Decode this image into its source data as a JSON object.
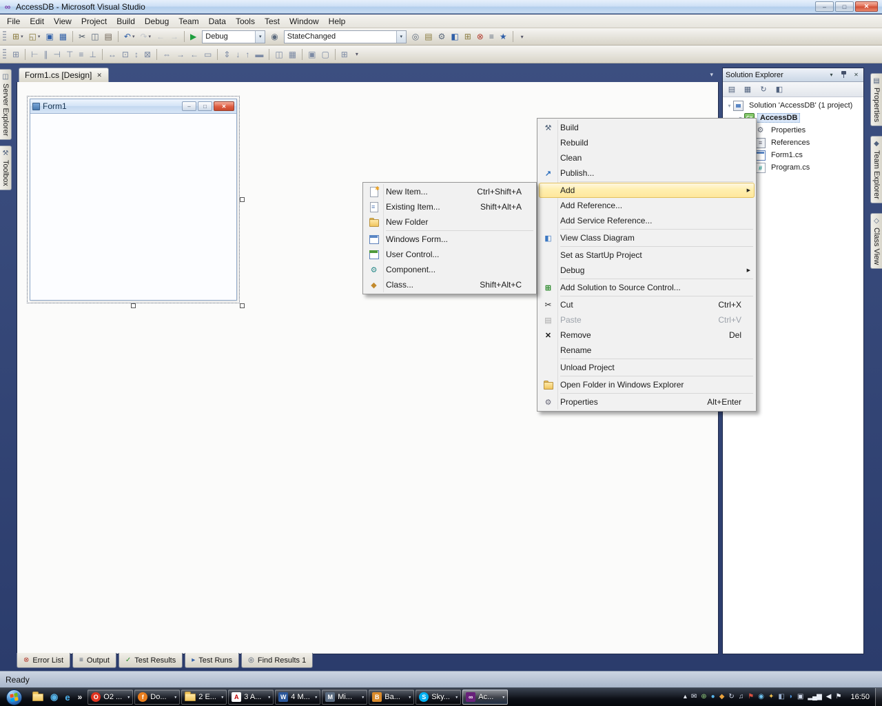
{
  "window": {
    "title": "AccessDB - Microsoft Visual Studio"
  },
  "icons": {
    "vs_logo": "∞",
    "minimize": "–",
    "maximize": "□",
    "close": "✕",
    "tab_close": "✕",
    "caret": "▾"
  },
  "menu_bar": [
    "File",
    "Edit",
    "View",
    "Project",
    "Build",
    "Debug",
    "Team",
    "Data",
    "Tools",
    "Test",
    "Window",
    "Help"
  ],
  "standard_toolbar": [
    {
      "type": "grip"
    },
    {
      "type": "button",
      "name": "add-new-item-button",
      "glyph": "⊞",
      "color": "#8a7b3f",
      "dropdown": true
    },
    {
      "type": "button",
      "name": "open-file-button",
      "glyph": "◱",
      "color": "#8a7b3f",
      "dropdown": true
    },
    {
      "type": "button",
      "name": "save-button",
      "glyph": "▣",
      "color": "#2f5fa8"
    },
    {
      "type": "button",
      "name": "save-all-button",
      "glyph": "▦",
      "color": "#2f5fa8"
    },
    {
      "type": "sep"
    },
    {
      "type": "button",
      "name": "cut-button",
      "glyph": "✂",
      "color": "#44505f"
    },
    {
      "type": "button",
      "name": "copy-button",
      "glyph": "◫",
      "color": "#5c6a7d"
    },
    {
      "type": "button",
      "name": "paste-button",
      "glyph": "▤",
      "color": "#6f6456"
    },
    {
      "type": "sep"
    },
    {
      "type": "button",
      "name": "undo-button",
      "glyph": "↶",
      "color": "#2f5fa8",
      "dropdown": true
    },
    {
      "type": "button",
      "name": "redo-button",
      "glyph": "↷",
      "color": "#9aa4b5",
      "dropdown": true,
      "disabled": true
    },
    {
      "type": "button",
      "name": "navigate-backward-button",
      "glyph": "←",
      "color": "#9aa4b5",
      "disabled": true
    },
    {
      "type": "button",
      "name": "navigate-forward-button",
      "glyph": "→",
      "color": "#9aa4b5",
      "disabled": true
    },
    {
      "type": "sep"
    },
    {
      "type": "button",
      "name": "start-debugging-button",
      "glyph": "▶",
      "color": "#1e9e3e"
    },
    {
      "type": "combo",
      "name": "solution-configurations-combo",
      "value": "Debug",
      "width": 92
    },
    {
      "type": "button",
      "name": "find-symbol-button",
      "glyph": "◉",
      "color": "#5c6a7d"
    },
    {
      "type": "combo",
      "name": "find-combo",
      "value": "StateChanged",
      "width": 178
    },
    {
      "type": "button",
      "name": "find-in-files-button",
      "glyph": "◎",
      "color": "#5c6a7d"
    },
    {
      "type": "button",
      "name": "solution-explorer-button",
      "glyph": "▤",
      "color": "#8a7b3f"
    },
    {
      "type": "button",
      "name": "properties-window-button",
      "glyph": "⚙",
      "color": "#5c6a7d"
    },
    {
      "type": "button",
      "name": "object-browser-button",
      "glyph": "◧",
      "color": "#2f5fa8"
    },
    {
      "type": "button",
      "name": "toolbox-button",
      "glyph": "⊞",
      "color": "#8a7b3f"
    },
    {
      "type": "button",
      "name": "error-list-button",
      "glyph": "⊗",
      "color": "#b23b2e"
    },
    {
      "type": "button",
      "name": "immediate-window-button",
      "glyph": "≡",
      "color": "#5c6a7d"
    },
    {
      "type": "button",
      "name": "start-page-button",
      "glyph": "★",
      "color": "#2f5fa8"
    },
    {
      "type": "sep"
    },
    {
      "type": "overflow",
      "name": "standard-toolbar-options"
    }
  ],
  "layout_toolbar": [
    {
      "type": "grip"
    },
    {
      "type": "button",
      "name": "snap-to-grid-button",
      "glyph": "⊞",
      "color": "#7c8aa4"
    },
    {
      "type": "sep"
    },
    {
      "type": "button",
      "name": "align-lefts-button",
      "glyph": "⊢",
      "color": "#7c8aa4"
    },
    {
      "type": "button",
      "name": "align-centers-button",
      "glyph": "∥",
      "color": "#7c8aa4"
    },
    {
      "type": "button",
      "name": "align-rights-button",
      "glyph": "⊣",
      "color": "#7c8aa4"
    },
    {
      "type": "button",
      "name": "align-tops-button",
      "glyph": "⊤",
      "color": "#7c8aa4"
    },
    {
      "type": "button",
      "name": "align-middles-button",
      "glyph": "≡",
      "color": "#7c8aa4"
    },
    {
      "type": "button",
      "name": "align-bottoms-button",
      "glyph": "⊥",
      "color": "#7c8aa4"
    },
    {
      "type": "sep"
    },
    {
      "type": "button",
      "name": "make-same-width-button",
      "glyph": "↔",
      "color": "#7c8aa4"
    },
    {
      "type": "button",
      "name": "size-to-grid-button",
      "glyph": "⊡",
      "color": "#7c8aa4"
    },
    {
      "type": "button",
      "name": "make-same-height-button",
      "glyph": "↕",
      "color": "#7c8aa4"
    },
    {
      "type": "button",
      "name": "make-same-size-button",
      "glyph": "⊠",
      "color": "#7c8aa4"
    },
    {
      "type": "sep"
    },
    {
      "type": "button",
      "name": "make-horizontal-spacing-equal-button",
      "glyph": "⇔",
      "color": "#7c8aa4"
    },
    {
      "type": "button",
      "name": "increase-horizontal-spacing-button",
      "glyph": "→",
      "color": "#7c8aa4"
    },
    {
      "type": "button",
      "name": "decrease-horizontal-spacing-button",
      "glyph": "←",
      "color": "#7c8aa4"
    },
    {
      "type": "button",
      "name": "remove-horizontal-spacing-button",
      "glyph": "▭",
      "color": "#7c8aa4"
    },
    {
      "type": "sep"
    },
    {
      "type": "button",
      "name": "make-vertical-spacing-equal-button",
      "glyph": "⇕",
      "color": "#7c8aa4"
    },
    {
      "type": "button",
      "name": "increase-vertical-spacing-button",
      "glyph": "↓",
      "color": "#7c8aa4"
    },
    {
      "type": "button",
      "name": "decrease-vertical-spacing-button",
      "glyph": "↑",
      "color": "#7c8aa4"
    },
    {
      "type": "button",
      "name": "remove-vertical-spacing-button",
      "glyph": "▬",
      "color": "#7c8aa4"
    },
    {
      "type": "sep"
    },
    {
      "type": "button",
      "name": "center-horizontally-button",
      "glyph": "◫",
      "color": "#7c8aa4"
    },
    {
      "type": "button",
      "name": "center-vertically-button",
      "glyph": "▦",
      "color": "#7c8aa4"
    },
    {
      "type": "sep"
    },
    {
      "type": "button",
      "name": "bring-to-front-button",
      "glyph": "▣",
      "color": "#7c8aa4"
    },
    {
      "type": "button",
      "name": "send-to-back-button",
      "glyph": "▢",
      "color": "#7c8aa4"
    },
    {
      "type": "sep"
    },
    {
      "type": "button",
      "name": "tab-order-button",
      "glyph": "⊞",
      "color": "#7c8aa4"
    },
    {
      "type": "overflow",
      "name": "layout-toolbar-options"
    }
  ],
  "side_tabs": {
    "left": [
      {
        "label": "Server Explorer",
        "icon": "server-explorer",
        "glyph": "◫"
      },
      {
        "label": "Toolbox",
        "icon": "toolbox",
        "glyph": "⚒"
      }
    ],
    "right": [
      {
        "label": "Properties",
        "icon": "properties-panel",
        "glyph": "▤"
      },
      {
        "label": "Team Explorer",
        "icon": "team-explorer",
        "glyph": "◆"
      },
      {
        "label": "Class View",
        "icon": "class-view",
        "glyph": "◇"
      }
    ]
  },
  "document_tab": {
    "label": "Form1.cs [Design]"
  },
  "designer": {
    "form_title": "Form1"
  },
  "solution_explorer": {
    "title": "Solution Explorer",
    "toolbar": [
      {
        "name": "properties-button",
        "glyph": "▤"
      },
      {
        "name": "show-all-files-button",
        "glyph": "▦"
      },
      {
        "name": "refresh-button",
        "glyph": "↻"
      },
      {
        "name": "view-class-diagram-button",
        "glyph": "◧"
      }
    ],
    "tree": [
      {
        "label": "Solution 'AccessDB' (1 project)",
        "icon": "solution",
        "level": 0,
        "expander": "▾"
      },
      {
        "label": "AccessDB",
        "icon": "project",
        "level": 1,
        "expander": "▾",
        "selected": true,
        "bold": true
      },
      {
        "label": "Properties",
        "icon": "properties",
        "level": 2
      },
      {
        "label": "References",
        "icon": "references",
        "level": 2
      },
      {
        "label": "Form1.cs",
        "icon": "form",
        "level": 2
      },
      {
        "label": "Program.cs",
        "icon": "csfile",
        "level": 2
      }
    ]
  },
  "context_menu": {
    "items": [
      {
        "label": "Build",
        "icon": "build"
      },
      {
        "label": "Rebuild"
      },
      {
        "label": "Clean"
      },
      {
        "label": "Publish...",
        "icon": "publish"
      },
      {
        "type": "separator"
      },
      {
        "label": "Add",
        "submenu": true,
        "highlighted": true
      },
      {
        "label": "Add Reference..."
      },
      {
        "label": "Add Service Reference..."
      },
      {
        "type": "separator"
      },
      {
        "label": "View Class Diagram",
        "icon": "class-diagram"
      },
      {
        "type": "separator"
      },
      {
        "label": "Set as StartUp Project"
      },
      {
        "label": "Debug",
        "submenu": true
      },
      {
        "type": "separator"
      },
      {
        "label": "Add Solution to Source Control...",
        "icon": "source-control"
      },
      {
        "type": "separator"
      },
      {
        "label": "Cut",
        "icon": "cut",
        "shortcut": "Ctrl+X"
      },
      {
        "label": "Paste",
        "icon": "paste",
        "shortcut": "Ctrl+V",
        "disabled": true
      },
      {
        "label": "Remove",
        "icon": "remove",
        "shortcut": "Del"
      },
      {
        "label": "Rename"
      },
      {
        "type": "separator"
      },
      {
        "label": "Unload Project"
      },
      {
        "type": "separator"
      },
      {
        "label": "Open Folder in Windows Explorer",
        "icon": "folder-open"
      },
      {
        "type": "separator"
      },
      {
        "label": "Properties",
        "icon": "properties",
        "shortcut": "Alt+Enter"
      }
    ]
  },
  "add_submenu": {
    "items": [
      {
        "label": "New Item...",
        "icon": "new-item",
        "shortcut": "Ctrl+Shift+A"
      },
      {
        "label": "Existing Item...",
        "icon": "existing-item",
        "shortcut": "Shift+Alt+A"
      },
      {
        "label": "New Folder",
        "icon": "new-folder"
      },
      {
        "type": "separator"
      },
      {
        "label": "Windows Form...",
        "icon": "windows-form"
      },
      {
        "label": "User Control...",
        "icon": "user-control"
      },
      {
        "label": "Component...",
        "icon": "component"
      },
      {
        "label": "Class...",
        "icon": "class",
        "shortcut": "Shift+Alt+C"
      }
    ]
  },
  "bottom_tabs": [
    {
      "label": "Error List",
      "icon": "error-list",
      "glyph": "⊗",
      "color": "#b23b2e"
    },
    {
      "label": "Output",
      "icon": "output",
      "glyph": "≡",
      "color": "#44536a"
    },
    {
      "label": "Test Results",
      "icon": "test-results",
      "glyph": "✓",
      "color": "#2e8b2e"
    },
    {
      "label": "Test Runs",
      "icon": "test-runs",
      "glyph": "▸",
      "color": "#2f5fa8"
    },
    {
      "label": "Find Results 1",
      "icon": "find-results",
      "glyph": "◎",
      "color": "#44536a"
    }
  ],
  "status_bar": {
    "text": "Ready"
  },
  "taskbar": {
    "quick_launch": [
      {
        "name": "quick-launch-folder",
        "icon": "folder"
      },
      {
        "name": "quick-launch-media-player",
        "glyph": "◉",
        "color": "#57b3e8"
      },
      {
        "name": "quick-launch-browser",
        "glyph": "e",
        "color": "#4db3f0"
      }
    ],
    "more_chevron": "»",
    "buttons": [
      {
        "label": "O2 ...",
        "name": "taskbar-button-o2",
        "icon": {
          "shape": "circle",
          "bg": "#e0331f",
          "glyph": "O",
          "color": "#fff"
        }
      },
      {
        "label": "Do...",
        "name": "taskbar-button-do",
        "icon": {
          "shape": "circle",
          "bg": "#e87d1e",
          "glyph": "f",
          "color": "#fff"
        }
      },
      {
        "label": "2 E...",
        "name": "taskbar-button-explorer-group",
        "icon": {
          "shape": "folder"
        }
      },
      {
        "label": "3 A...",
        "name": "taskbar-button-adobe-group",
        "icon": {
          "shape": "square",
          "bg": "#ffffff",
          "glyph": "A",
          "color": "#c00000"
        }
      },
      {
        "label": "4 M...",
        "name": "taskbar-button-word-group",
        "icon": {
          "shape": "square",
          "bg": "#2b579a",
          "glyph": "W",
          "color": "#fff"
        }
      },
      {
        "label": "Mi...",
        "name": "taskbar-button-mi",
        "icon": {
          "shape": "square",
          "bg": "#5a6b80",
          "glyph": "M",
          "color": "#fff"
        }
      },
      {
        "label": "Ba...",
        "name": "taskbar-button-ba",
        "icon": {
          "shape": "square",
          "bg": "#d98a2b",
          "glyph": "B",
          "color": "#fff"
        }
      },
      {
        "label": "Sky...",
        "name": "taskbar-button-skype",
        "icon": {
          "shape": "circle",
          "bg": "#00aff0",
          "glyph": "S",
          "color": "#fff"
        }
      },
      {
        "label": "Ac...",
        "name": "taskbar-button-accessdb",
        "active": true,
        "icon": {
          "shape": "square",
          "bg": "#68217a",
          "glyph": "∞",
          "color": "#fff"
        }
      }
    ],
    "tray": [
      {
        "name": "hidden-icons-button",
        "glyph": "▴",
        "color": "#e8edf5"
      },
      {
        "name": "tray-mail-icon",
        "glyph": "✉",
        "color": "#dfe6f2"
      },
      {
        "name": "tray-update-icon",
        "glyph": "⊕",
        "color": "#8fc97a"
      },
      {
        "name": "tray-messenger-icon",
        "glyph": "●",
        "color": "#57b3e8"
      },
      {
        "name": "tray-antivirus-icon",
        "glyph": "◆",
        "color": "#e8a13d"
      },
      {
        "name": "tray-sync-icon",
        "glyph": "↻",
        "color": "#cfd8ea"
      },
      {
        "name": "tray-media-icon",
        "glyph": "♫",
        "color": "#cfd8ea"
      },
      {
        "name": "tray-alert-icon",
        "glyph": "⚑",
        "color": "#d84f3f"
      },
      {
        "name": "tray-app-icon-1",
        "glyph": "◉",
        "color": "#6fc2ef"
      },
      {
        "name": "tray-app-icon-2",
        "glyph": "✦",
        "color": "#f2c14e"
      },
      {
        "name": "tray-app-icon-3",
        "glyph": "◧",
        "color": "#9ab0cf"
      },
      {
        "name": "tray-bluetooth-icon",
        "glyph": "◗",
        "color": "#4a90d9"
      },
      {
        "name": "tray-display-icon",
        "glyph": "▣",
        "color": "#cfd8ea"
      },
      {
        "name": "tray-network-icon",
        "glyph": "▂▄▆",
        "color": "#e8edf5"
      },
      {
        "name": "tray-volume-icon",
        "glyph": "◀",
        "color": "#e8edf5"
      },
      {
        "name": "tray-action-center-icon",
        "glyph": "⚑",
        "color": "#e8edf5"
      }
    ],
    "clock": "16:50"
  }
}
